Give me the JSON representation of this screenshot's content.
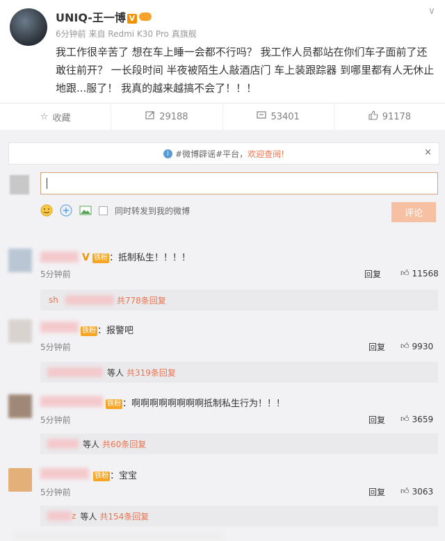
{
  "post": {
    "username": "UNIQ-王一博",
    "verified_badge": "V",
    "meta": "6分钟前 来自 Redmi K30 Pro 真旗舰",
    "content": "我工作很辛苦了 想在车上睡一会都不行吗？ 我工作人员都站在你们车子面前了还敢往前开？ 一长段时间 半夜被陌生人敲酒店门 车上装跟踪器 到哪里都有人无休止地跟...服了！ 我真的越来越搞不会了！！！",
    "menu_icon": "chevron-down-icon"
  },
  "actions": {
    "favorite_label": "收藏",
    "repost_count": "29188",
    "comment_count": "53401",
    "like_count": "91178"
  },
  "notice": {
    "prefix": "#微博辟谣#平台，",
    "highlight": "欢迎查阅!",
    "close": "×"
  },
  "composer": {
    "sync_label": "同时转发到我的微博",
    "submit_label": "评论"
  },
  "fan_badge": "铁粉",
  "comments": [
    {
      "name_suffix": "V",
      "text": "：抵制私生！！！！",
      "time": "5分钟前",
      "reply_label": "回复",
      "likes": "11568",
      "sub_prefix": "sh",
      "sub_who": "",
      "sub_count": "共778条回复"
    },
    {
      "name_suffix": "",
      "text": "：报警吧",
      "time": "5分钟前",
      "reply_label": "回复",
      "likes": "9930",
      "sub_prefix": "",
      "sub_who": "等人",
      "sub_count": "共319条回复"
    },
    {
      "name_suffix": "",
      "text": "：啊啊啊啊啊啊啊啊抵制私生行为！！！",
      "time": "5分钟前",
      "reply_label": "回复",
      "likes": "3659",
      "sub_prefix": "",
      "sub_who": "等人",
      "sub_count": "共60条回复"
    },
    {
      "name_suffix": "",
      "text": "：宝宝",
      "time": "5分钟前",
      "reply_label": "回复",
      "likes": "3063",
      "sub_prefix": "z",
      "sub_who": "等人",
      "sub_count": "共154条回复"
    }
  ],
  "colors": {
    "accent": "#eb7350",
    "verified": "#f29100",
    "fan_badge": "#f6a623",
    "background": "#f2f2f5"
  }
}
